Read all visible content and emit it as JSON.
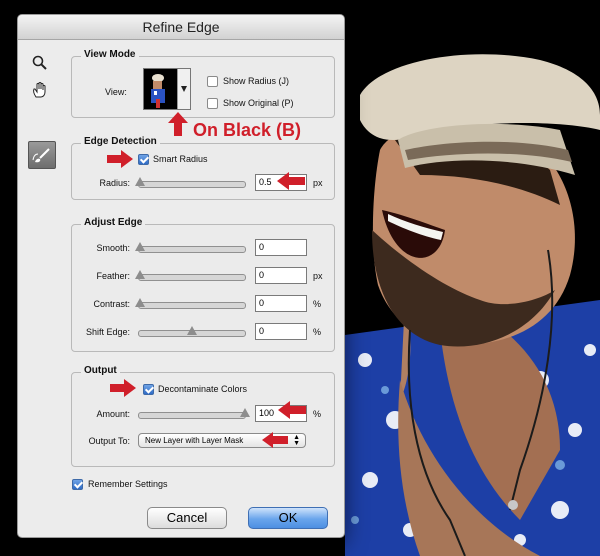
{
  "dialog": {
    "title": "Refine Edge"
  },
  "view_mode": {
    "legend": "View Mode",
    "view_label": "View:",
    "show_radius": {
      "label": "Show Radius (J)",
      "checked": false
    },
    "show_original": {
      "label": "Show Original (P)",
      "checked": false
    }
  },
  "edge_detection": {
    "legend": "Edge Detection",
    "smart_radius": {
      "label": "Smart Radius",
      "checked": true
    },
    "radius": {
      "label": "Radius:",
      "value": "0.5",
      "unit": "px",
      "slider_fraction": 0.0
    }
  },
  "adjust_edge": {
    "legend": "Adjust Edge",
    "smooth": {
      "label": "Smooth:",
      "value": "0",
      "unit": "",
      "slider_fraction": 0.0
    },
    "feather": {
      "label": "Feather:",
      "value": "0",
      "unit": "px",
      "slider_fraction": 0.0
    },
    "contrast": {
      "label": "Contrast:",
      "value": "0",
      "unit": "%",
      "slider_fraction": 0.0
    },
    "shift_edge": {
      "label": "Shift Edge:",
      "value": "0",
      "unit": "%",
      "slider_fraction": 0.5
    }
  },
  "output": {
    "legend": "Output",
    "decontaminate": {
      "label": "Decontaminate Colors",
      "checked": true
    },
    "amount": {
      "label": "Amount:",
      "value": "100",
      "unit": "%",
      "slider_fraction": 1.0
    },
    "output_to": {
      "label": "Output To:",
      "value": "New Layer with Layer Mask"
    }
  },
  "remember": {
    "label": "Remember Settings",
    "checked": true
  },
  "buttons": {
    "cancel": "Cancel",
    "ok": "OK"
  },
  "annotation": {
    "callout": "On Black (B)",
    "color": "#d01f2a"
  },
  "icons": {
    "tools": [
      "zoom-icon",
      "hand-icon",
      "refine-radius-brush-icon"
    ],
    "annotation_arrows": "red-arrow-icon"
  }
}
